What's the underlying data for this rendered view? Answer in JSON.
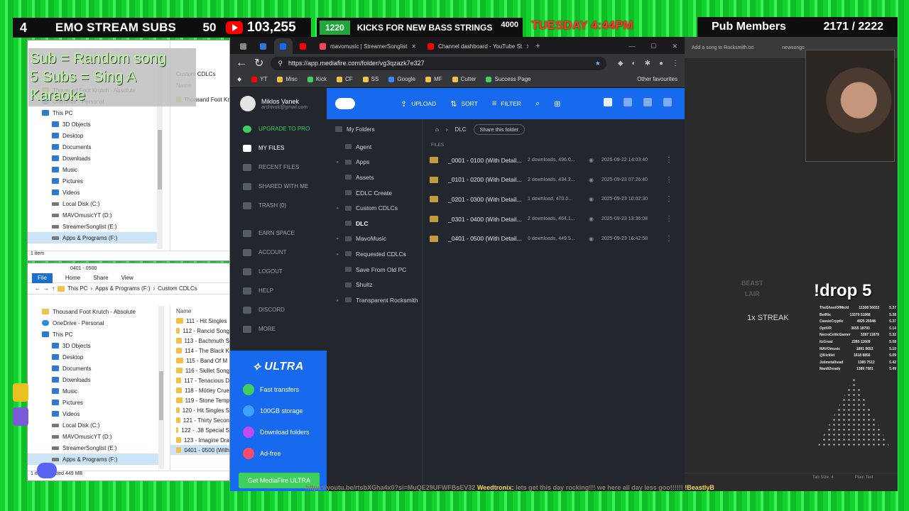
{
  "overlay": {
    "subs_count": "4",
    "subs_label": "EMO STREAM SUBS",
    "subs_goal": "50",
    "yt_count": "103,255",
    "kicks_count": "1220",
    "kicks_label": "KICKS FOR NEW BASS STRINGS",
    "kicks_goal": "4000",
    "date_text": "TUESDAY 4:44PM",
    "pub_label": "Pub Members",
    "pub_count": "2171 / 2222",
    "sub_note_1": "Sub = Random song",
    "sub_note_2": "5 Subs = Sing A Karaoke"
  },
  "explorer1": {
    "tree": [
      {
        "label": "Thousand Foot Krutch - Absolute",
        "icon": "folder"
      },
      {
        "label": "OneDrive - Personal",
        "icon": "cloud"
      },
      {
        "label": "This PC",
        "icon": "blue"
      },
      {
        "label": "3D Objects",
        "icon": "blue"
      },
      {
        "label": "Desktop",
        "icon": "blue"
      },
      {
        "label": "Documents",
        "icon": "blue"
      },
      {
        "label": "Downloads",
        "icon": "blue"
      },
      {
        "label": "Music",
        "icon": "blue"
      },
      {
        "label": "Pictures",
        "icon": "blue"
      },
      {
        "label": "Videos",
        "icon": "blue"
      },
      {
        "label": "Local Disk (C:)",
        "icon": "drive"
      },
      {
        "label": "MAVOmusicYT (D:)",
        "icon": "drive"
      },
      {
        "label": "StreamerSonglist (E:)",
        "icon": "drive"
      },
      {
        "label": "Apps & Programs (F:)",
        "icon": "drive"
      }
    ],
    "col_name": "Name",
    "path_tail": "Custom CDLCs",
    "files": [
      "Thousand Foot Kr"
    ],
    "status": "1 item"
  },
  "explorer2": {
    "title": "0401 - 0500",
    "ribbon": [
      "File",
      "Home",
      "Share",
      "View"
    ],
    "path": [
      "This PC",
      "Apps & Programs (F:)",
      "Custom CDLCs"
    ],
    "tree": [
      {
        "label": "Thousand Foot Krutch - Absolute",
        "icon": "folder"
      },
      {
        "label": "OneDrive - Personal",
        "icon": "cloud"
      },
      {
        "label": "This PC",
        "icon": "blue"
      },
      {
        "label": "3D Objects",
        "icon": "blue"
      },
      {
        "label": "Desktop",
        "icon": "blue"
      },
      {
        "label": "Documents",
        "icon": "blue"
      },
      {
        "label": "Downloads",
        "icon": "blue"
      },
      {
        "label": "Music",
        "icon": "blue"
      },
      {
        "label": "Pictures",
        "icon": "blue"
      },
      {
        "label": "Videos",
        "icon": "blue"
      },
      {
        "label": "Local Disk (C:)",
        "icon": "drive"
      },
      {
        "label": "MAVOmusicYT (D:)",
        "icon": "drive"
      },
      {
        "label": "StreamerSonglist (E:)",
        "icon": "drive"
      },
      {
        "label": "Apps & Programs (F:)",
        "icon": "drive"
      }
    ],
    "col_name": "Name",
    "files": [
      "111 - Hit Singles",
      "112 - Rancid Song",
      "113 - Bachmuth S",
      "114 - The Black K",
      "115 - Band Of M",
      "116 - Skillet Song",
      "117 - Tenacious D",
      "118 - Mötley Crue",
      "119 - Stone Temp",
      "120 - Hit Singles S",
      "121 - Thirty Secon",
      "122 - .38 Special S",
      "123 - Imagine Dra",
      "0401 - 0500 (With"
    ],
    "status": "1 item selected  449 MB"
  },
  "browser": {
    "tabs": [
      {
        "label": "mavomusic | StreamerSonglist",
        "color": "#ff4455",
        "active": false
      },
      {
        "label": "Channel dashboard - YouTube St",
        "color": "#ff0000",
        "active": false
      }
    ],
    "url": "https://app.mediafire.com/folder/vg3qzazk7e327",
    "bookmarks": [
      "YT",
      "Misc",
      "Kick",
      "CF",
      "SS",
      "Google",
      "MF",
      "Cutter",
      "Success Page"
    ],
    "other_bookmarks": "Other favourites"
  },
  "mediafire": {
    "user_name": "Miklos Vanek",
    "user_email": "archivuk@gmail.com",
    "nav": [
      {
        "label": "UPGRADE TO PRO",
        "key": "upgrade"
      },
      {
        "label": "MY FILES",
        "key": "active"
      },
      {
        "label": "RECENT FILES",
        "key": ""
      },
      {
        "label": "SHARED WITH ME",
        "key": ""
      },
      {
        "label": "TRASH (0)",
        "key": ""
      },
      {
        "label": "EARN SPACE",
        "key": ""
      },
      {
        "label": "ACCOUNT",
        "key": ""
      },
      {
        "label": "LOGOUT",
        "key": ""
      },
      {
        "label": "HELP",
        "key": ""
      },
      {
        "label": "DISCORD",
        "key": ""
      },
      {
        "label": "MORE",
        "key": ""
      }
    ],
    "ultra": {
      "title": "ULTRA",
      "features": [
        {
          "label": "Fast transfers",
          "color": "#3ecf5c"
        },
        {
          "label": "100GB storage",
          "color": "#3ea0ff"
        },
        {
          "label": "Download folders",
          "color": "#c04cf0"
        },
        {
          "label": "Ad-free",
          "color": "#ff4a6a"
        }
      ],
      "button": "Get MediaFire ULTRA"
    },
    "toolbar": {
      "upload": "UPLOAD",
      "sort": "SORT",
      "filter": "FILTER"
    },
    "folders_root": "My Folders",
    "folders": [
      "Agent",
      "Apps",
      "Assets",
      "CDLC Create",
      "Custom CDLCs",
      "DLC",
      "MavoMusic",
      "Requested CDLCs",
      "Save From Old PC",
      "Shultz",
      "Transparent Rocksmith"
    ],
    "current_folder": "DLC",
    "share_button": "Share this folder",
    "files_label": "FILES",
    "files": [
      {
        "name": "_0001 - 0100 (With Detail...",
        "downloads": "2 downloads, 496.0...",
        "date": "2025-09-22 14:03:40"
      },
      {
        "name": "_0101 - 0200 (With Detail...",
        "downloads": "2 downloads, 434.2...",
        "date": "2025-09-23 07:26:40"
      },
      {
        "name": "_0201 - 0300 (With Detail...",
        "downloads": "1 download, 470.0...",
        "date": "2025-09-23 10:02:30"
      },
      {
        "name": "_0301 - 0400 (With Detail...",
        "downloads": "2 downloads, 464.1...",
        "date": "2025-09-23 13:36:08"
      },
      {
        "name": "_0401 - 0500 (With Detail...",
        "downloads": "0 downloads, 449.5...",
        "date": "2025-09-23 16:42:58"
      }
    ]
  },
  "right": {
    "tab1": "Add a song to Rocksmith.txt",
    "tab2": "newsongs",
    "beast_line1": "BEAST",
    "beast_line2": "LAIR",
    "streak": "1x STREAK",
    "drop": "!drop 5",
    "leaderboard": [
      [
        "TheGhostOfMicki",
        "11308 56022",
        "5.37"
      ],
      [
        "BetRix",
        "13379 51868",
        "5.38"
      ],
      [
        "CassieCryptic",
        "4925 25948",
        "5.37"
      ],
      [
        "OptiVR",
        "3655 18793",
        "5.14"
      ],
      [
        "NecroCelticGamer",
        "3287 11879",
        "5.32"
      ],
      [
        "ItzGreat",
        "2285 11609",
        "5.08"
      ],
      [
        "MAVOmusic",
        "1891 9652",
        "5.10"
      ],
      [
        "@Kicklet",
        "1618 8856",
        "5.09"
      ],
      [
        "Julimetalhead",
        "1385 7512",
        "5.42"
      ],
      [
        "Mardi2ready",
        "1389 7581",
        "5.49"
      ]
    ],
    "status_a": "Tab Size: 4",
    "status_b": "Plain Text"
  },
  "ticker": {
    "link": "https://youtu.be/rtsbXGha4x0?si=MuQE29UFWFBsEV32",
    "user": "Weedtronix:",
    "message": "lets get this day rocking!!! we here all day less goo!!!!!!",
    "tail": "!BeastlyB"
  },
  "colors": {
    "mediafire_blue": "#1769ee",
    "green": "#3ecf5c",
    "dark_bg": "#22272e"
  }
}
